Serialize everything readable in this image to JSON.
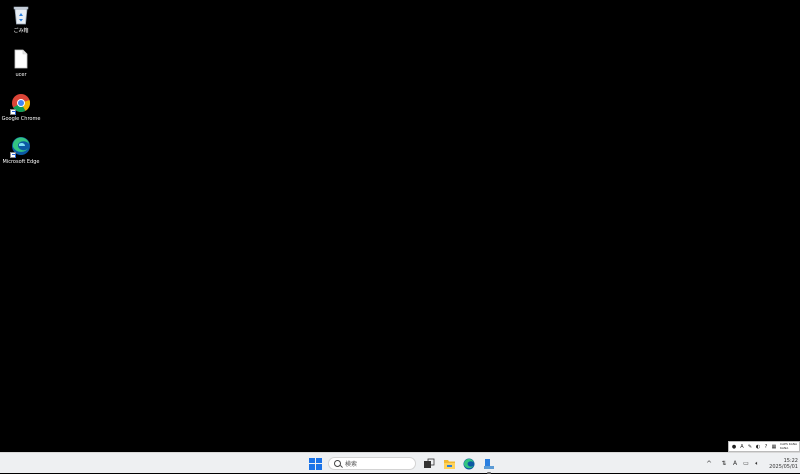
{
  "desktop": {
    "icons": [
      {
        "label": "ごみ箱",
        "icon": "recycle-bin-icon"
      },
      {
        "label": "ucer",
        "icon": "file-icon"
      },
      {
        "label": "Google Chrome",
        "icon": "chrome-icon"
      },
      {
        "label": "Microsoft Edge",
        "icon": "edge-icon"
      }
    ]
  },
  "taskbar": {
    "search_placeholder": "検索",
    "apps": [
      "start-icon",
      "search-box",
      "task-view-icon",
      "file-explorer-icon",
      "edge-icon",
      "app-icon"
    ],
    "clock_time": "15:22",
    "clock_date": "2025/05/01",
    "ime_indicator": "A"
  },
  "ime_toolbar": {
    "label_top": "CAPS KANA",
    "label_bottom": "KANA"
  },
  "colors": {
    "desktop_bg": "#000000",
    "taskbar_bg": "#eef0f2",
    "accent": "#1a73e8"
  }
}
